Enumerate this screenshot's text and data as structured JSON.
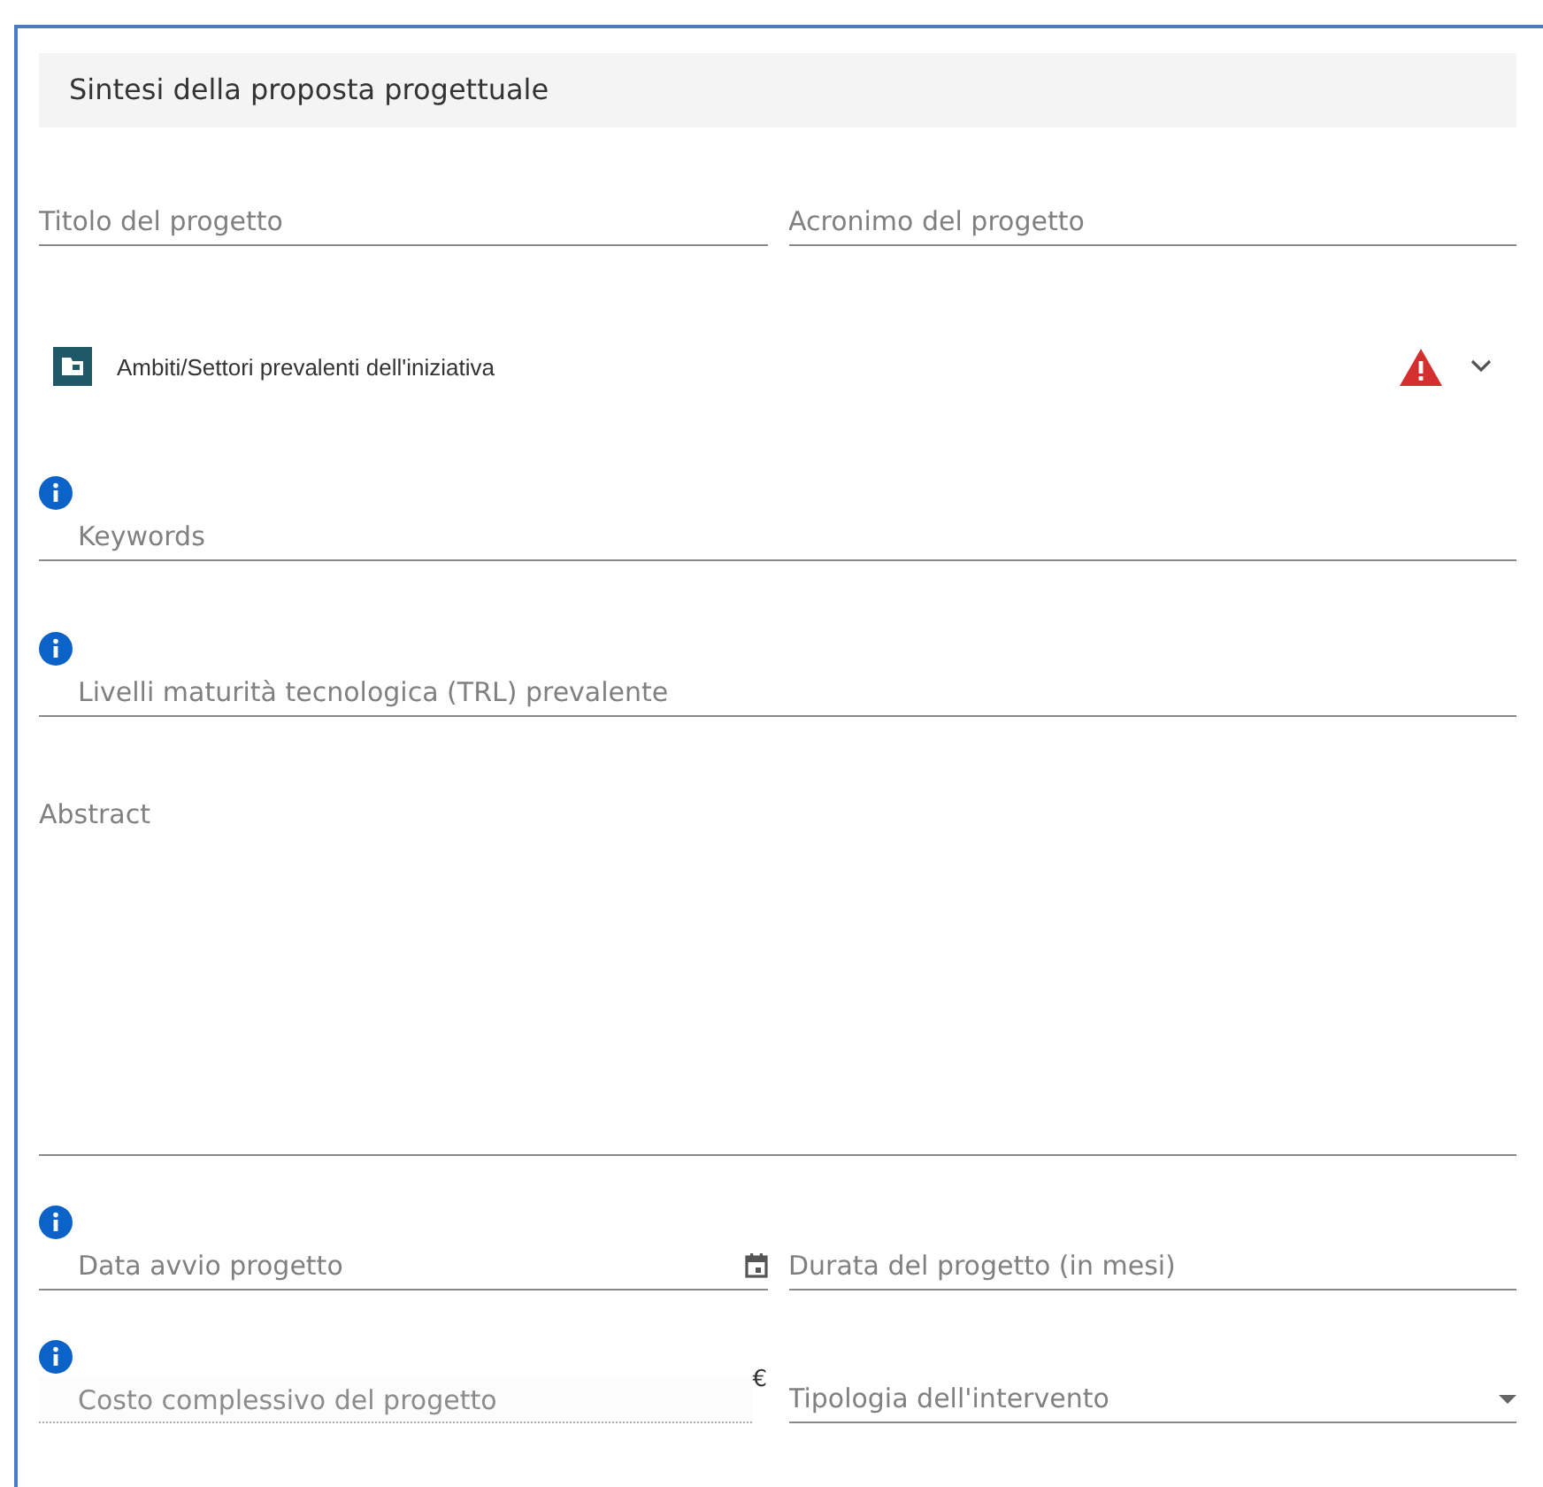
{
  "section_title": "Sintesi della proposta progettuale",
  "rows": [
    {
      "fields": [
        {
          "kind": "text",
          "placeholder": "Titolo del progetto",
          "info": false,
          "disabled": false
        },
        {
          "kind": "text",
          "placeholder": "Acronimo del progetto",
          "info": false,
          "disabled": false
        }
      ]
    },
    {
      "accordion": {
        "label": "Ambiti/Settori prevalenti dell'iniziativa",
        "warning": true,
        "expanded": false
      }
    },
    {
      "fields": [
        {
          "kind": "text",
          "placeholder": "Keywords",
          "info": true,
          "disabled": false
        }
      ]
    },
    {
      "fields": [
        {
          "kind": "text",
          "placeholder": "Livelli maturità tecnologica (TRL) prevalente",
          "info": true,
          "disabled": false
        }
      ]
    },
    {
      "fields": [
        {
          "kind": "textarea",
          "placeholder": "Abstract",
          "info": false,
          "disabled": false
        }
      ]
    },
    {
      "fields": [
        {
          "kind": "date",
          "placeholder": "Data avvio progetto",
          "info": true,
          "disabled": false
        },
        {
          "kind": "text",
          "placeholder": "Durata del progetto (in mesi)",
          "info": false,
          "disabled": false
        }
      ]
    },
    {
      "fields": [
        {
          "kind": "currency",
          "placeholder": "Costo complessivo del progetto",
          "suffix": "€",
          "info": true,
          "disabled": true
        },
        {
          "kind": "select",
          "placeholder": "Tipologia dell'intervento",
          "info": false,
          "disabled": false
        }
      ]
    }
  ]
}
